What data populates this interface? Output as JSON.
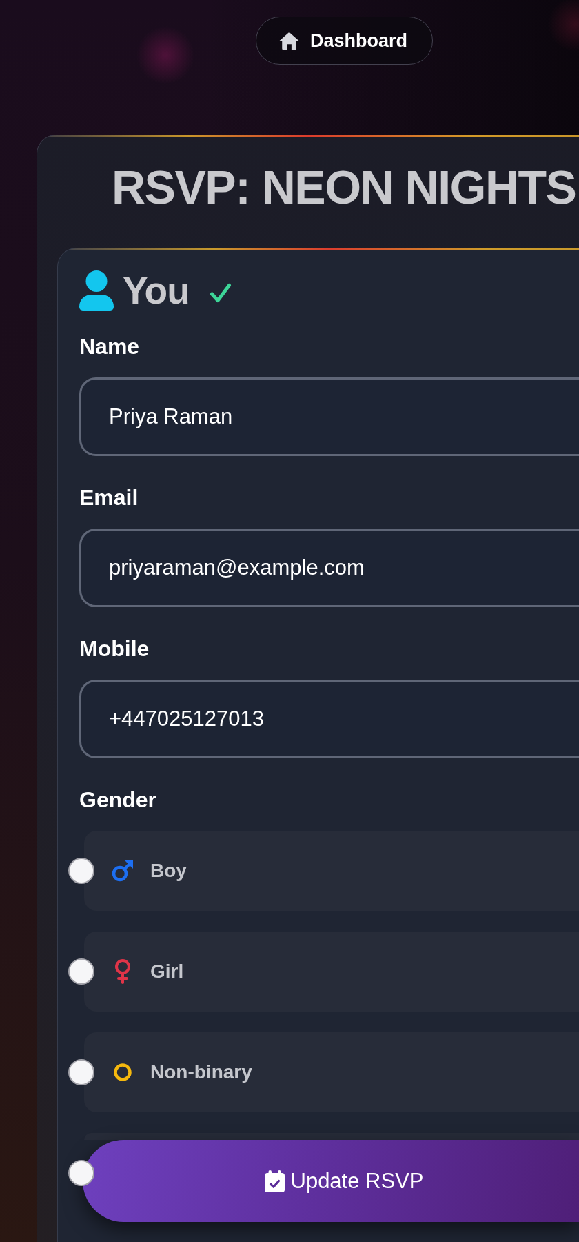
{
  "nav": {
    "dashboard_link": {
      "label": "Dashboard"
    }
  },
  "event": {
    "title": "RSVP: NEON NIGHTS"
  },
  "guest": {
    "heading": "You",
    "complete": true,
    "fields": [
      {
        "label": "Name",
        "value": "Priya Raman"
      },
      {
        "label": "Email",
        "value": "priyaraman@example.com"
      },
      {
        "label": "Mobile",
        "value": "+447025127013"
      }
    ],
    "gender": {
      "label": "Gender",
      "options": [
        {
          "kind": "male",
          "label": "Boy",
          "selected": false
        },
        {
          "kind": "female",
          "label": "Girl",
          "selected": false
        },
        {
          "kind": "nonbinary",
          "label": "Non-binary",
          "selected": false
        },
        {
          "selected": false
        }
      ]
    }
  },
  "submit": {
    "label": "Update RSVP"
  }
}
